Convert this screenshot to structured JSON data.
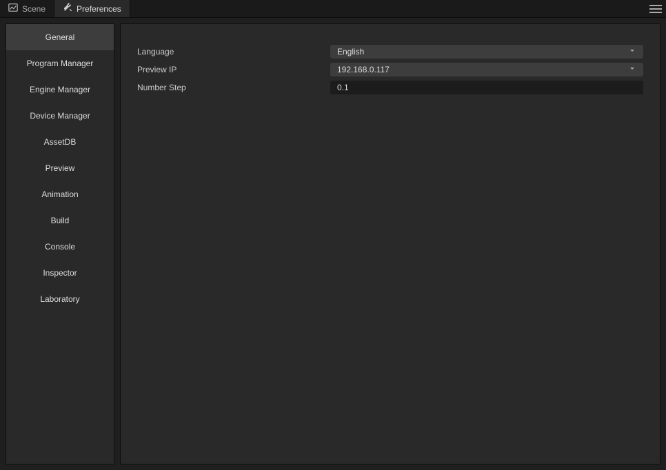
{
  "tabs": [
    {
      "label": "Scene",
      "active": false
    },
    {
      "label": "Preferences",
      "active": true
    }
  ],
  "sidebar": {
    "items": [
      {
        "label": "General",
        "active": true
      },
      {
        "label": "Program Manager",
        "active": false
      },
      {
        "label": "Engine Manager",
        "active": false
      },
      {
        "label": "Device Manager",
        "active": false
      },
      {
        "label": "AssetDB",
        "active": false
      },
      {
        "label": "Preview",
        "active": false
      },
      {
        "label": "Animation",
        "active": false
      },
      {
        "label": "Build",
        "active": false
      },
      {
        "label": "Console",
        "active": false
      },
      {
        "label": "Inspector",
        "active": false
      },
      {
        "label": "Laboratory",
        "active": false
      }
    ]
  },
  "form": {
    "language": {
      "label": "Language",
      "value": "English"
    },
    "preview_ip": {
      "label": "Preview IP",
      "value": "192.168.0.117"
    },
    "number_step": {
      "label": "Number Step",
      "value": "0.1"
    }
  }
}
